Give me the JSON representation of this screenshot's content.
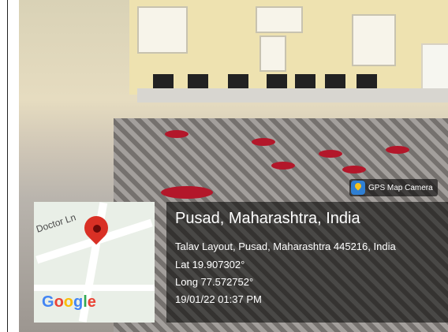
{
  "overlay": {
    "badge_label": "GPS Map Camera",
    "city": "Pusad, Maharashtra, India",
    "address": "Talav Layout, Pusad, Maharashtra 445216, India",
    "lat": "Lat 19.907302°",
    "long": "Long 77.572752°",
    "datetime": "19/01/22 01:37 PM"
  },
  "map": {
    "street_label": "Doctor Ln",
    "logo_text": "Google"
  },
  "colors": {
    "pin": "#d93025",
    "infobox_bg": "rgba(0,0,0,0.55)",
    "badge_icon_bg": "#2f7fd3"
  }
}
